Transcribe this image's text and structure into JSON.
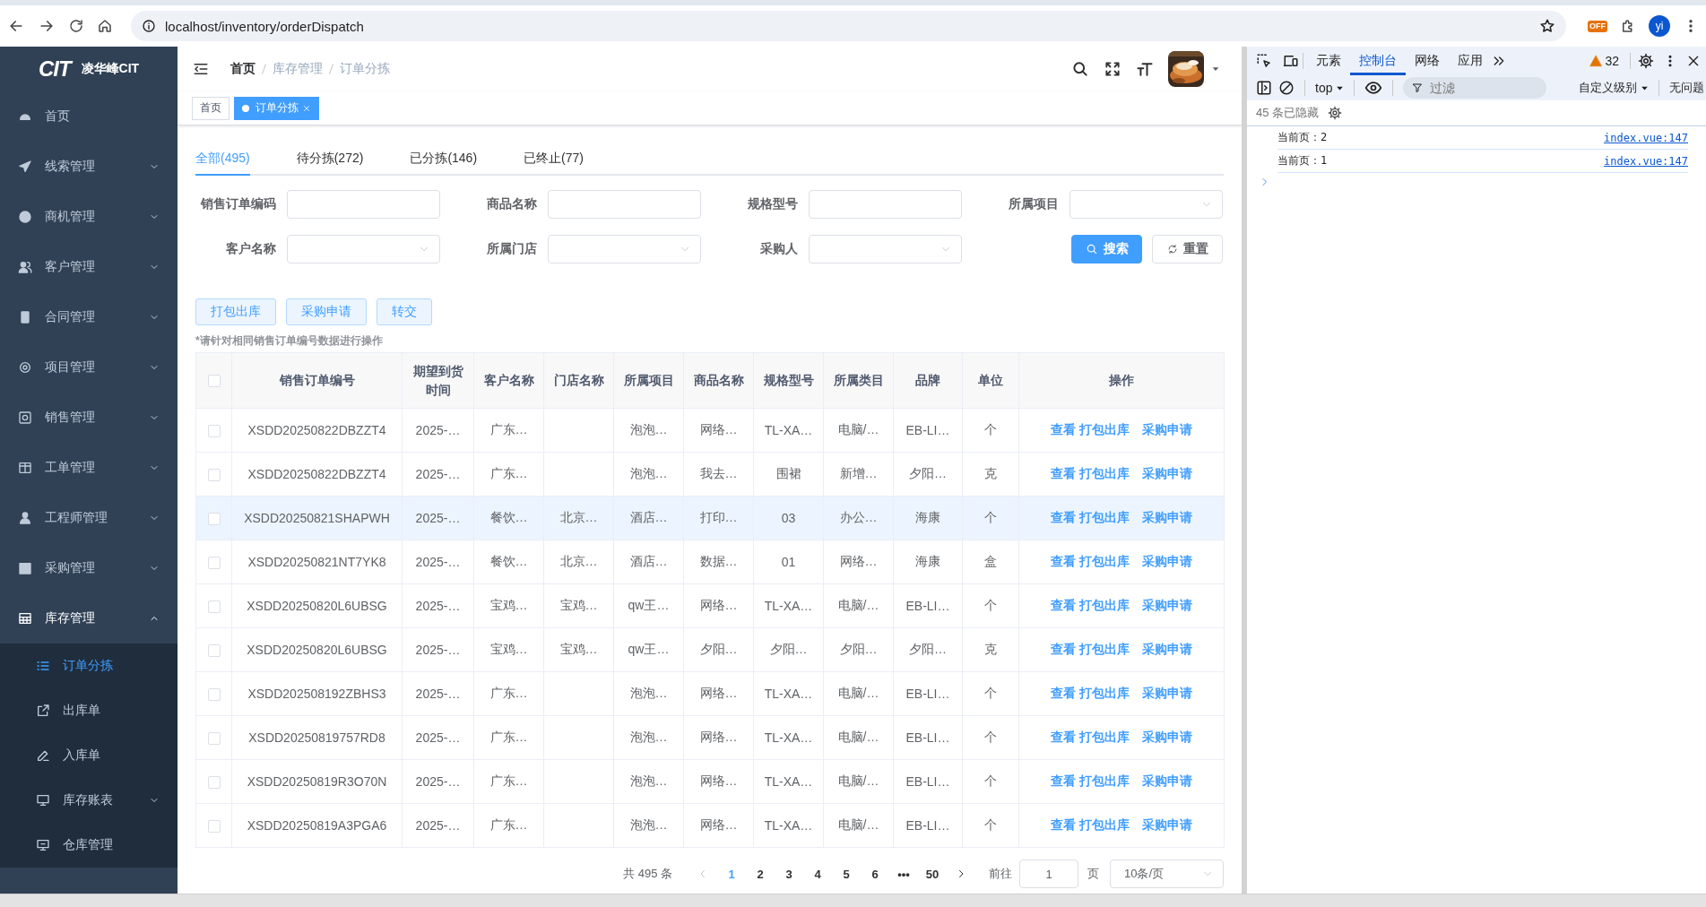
{
  "browser": {
    "url": "localhost/inventory/orderDispatch",
    "extension_badge": "OFF",
    "profile": "yi"
  },
  "sidebar": {
    "logo_mark": "CIT",
    "logo_text": "凌华峰CIT",
    "items": [
      {
        "label": "首页",
        "selected": false
      },
      {
        "label": "线索管理",
        "expanded": false,
        "selected": false
      },
      {
        "label": "商机管理",
        "expanded": false,
        "selected": false
      },
      {
        "label": "客户管理",
        "expanded": false,
        "selected": false
      },
      {
        "label": "合同管理",
        "expanded": false,
        "selected": false
      },
      {
        "label": "项目管理",
        "expanded": false,
        "selected": false
      },
      {
        "label": "销售管理",
        "expanded": false,
        "selected": false
      },
      {
        "label": "工单管理",
        "expanded": false,
        "selected": false
      },
      {
        "label": "工程师管理",
        "expanded": false,
        "selected": false
      },
      {
        "label": "采购管理",
        "expanded": false,
        "selected": false
      },
      {
        "label": "库存管理",
        "expanded": true,
        "selected": false,
        "children": [
          {
            "label": "订单分拣",
            "selected": true
          },
          {
            "label": "出库单",
            "selected": false
          },
          {
            "label": "入库单",
            "selected": false
          },
          {
            "label": "库存账表",
            "expanded": false,
            "selected": false
          },
          {
            "label": "仓库管理",
            "selected": false
          }
        ]
      }
    ]
  },
  "header": {
    "breadcrumb": [
      "首页",
      "库存管理",
      "订单分拣"
    ]
  },
  "tags": [
    {
      "label": "首页",
      "selected": false
    },
    {
      "label": "订单分拣",
      "selected": true
    }
  ],
  "tabs": [
    {
      "label": "全部(495)",
      "selected": true
    },
    {
      "label": "待分拣(272)",
      "selected": false
    },
    {
      "label": "已分拣(146)",
      "selected": false
    },
    {
      "label": "已终止(77)",
      "selected": false
    }
  ],
  "filters": [
    {
      "label": "销售订单编码",
      "kind": "input"
    },
    {
      "label": "商品名称",
      "kind": "input"
    },
    {
      "label": "规格型号",
      "kind": "input"
    },
    {
      "label": "所属项目",
      "kind": "select"
    },
    {
      "label": "客户名称",
      "kind": "select"
    },
    {
      "label": "所属门店",
      "kind": "select"
    },
    {
      "label": "采购人",
      "kind": "select"
    }
  ],
  "filter_buttons": [
    {
      "label": "搜索",
      "kind": "primary"
    },
    {
      "label": "重置",
      "kind": "default"
    }
  ],
  "actions": [
    "打包出库",
    "采购申请",
    "转交"
  ],
  "note": "*请针对相同销售订单编号数据进行操作",
  "table": {
    "all_checked": false,
    "columns": [
      "销售订单编号",
      "期望到货时间",
      "客户名称",
      "门店名称",
      "所属项目",
      "商品名称",
      "规格型号",
      "所属类目",
      "品牌",
      "单位",
      "操作"
    ],
    "rows": [
      {
        "checked": false,
        "selected": false,
        "order_no": "XSDD20250822DBZZT4",
        "expected_arrival": "2025-…",
        "customer": "广东…",
        "project": "泡泡…",
        "product": "网络…",
        "spec": "TL-XA…",
        "category": "电脑/…",
        "brand": "EB-LI…",
        "unit": "个",
        "actions": [
          "查看",
          "打包出库",
          "采购申请"
        ]
      },
      {
        "checked": false,
        "selected": false,
        "order_no": "XSDD20250822DBZZT4",
        "expected_arrival": "2025-…",
        "customer": "广东…",
        "project": "泡泡…",
        "product": "我去…",
        "spec": "围裙",
        "category": "新增…",
        "brand": "夕阳…",
        "unit": "克",
        "actions": [
          "查看",
          "打包出库",
          "采购申请"
        ]
      },
      {
        "checked": false,
        "selected": true,
        "order_no": "XSDD20250821SHAPWH",
        "expected_arrival": "2025-…",
        "customer": "餐饮…",
        "store": "北京…",
        "project": "酒店…",
        "product": "打印…",
        "spec": "03",
        "category": "办公…",
        "brand": "海康",
        "unit": "个",
        "actions": [
          "查看",
          "打包出库",
          "采购申请"
        ]
      },
      {
        "checked": false,
        "selected": false,
        "order_no": "XSDD20250821NT7YK8",
        "expected_arrival": "2025-…",
        "customer": "餐饮…",
        "store": "北京…",
        "project": "酒店…",
        "product": "数据…",
        "spec": "01",
        "category": "网络…",
        "brand": "海康",
        "unit": "盒",
        "actions": [
          "查看",
          "打包出库",
          "采购申请"
        ]
      },
      {
        "checked": false,
        "selected": false,
        "order_no": "XSDD20250820L6UBSG",
        "expected_arrival": "2025-…",
        "customer": "宝鸡…",
        "store": "宝鸡…",
        "project": "qw王…",
        "product": "网络…",
        "spec": "TL-XA…",
        "category": "电脑/…",
        "brand": "EB-LI…",
        "unit": "个",
        "actions": [
          "查看",
          "打包出库",
          "采购申请"
        ]
      },
      {
        "checked": false,
        "selected": false,
        "order_no": "XSDD20250820L6UBSG",
        "expected_arrival": "2025-…",
        "customer": "宝鸡…",
        "store": "宝鸡…",
        "project": "qw王…",
        "product": "夕阳…",
        "spec": "夕阳…",
        "category": "夕阳…",
        "brand": "夕阳…",
        "unit": "克",
        "actions": [
          "查看",
          "打包出库",
          "采购申请"
        ]
      },
      {
        "checked": false,
        "selected": false,
        "order_no": "XSDD202508192ZBHS3",
        "expected_arrival": "2025-…",
        "customer": "广东…",
        "project": "泡泡…",
        "product": "网络…",
        "spec": "TL-XA…",
        "category": "电脑/…",
        "brand": "EB-LI…",
        "unit": "个",
        "actions": [
          "查看",
          "打包出库",
          "采购申请"
        ]
      },
      {
        "checked": false,
        "selected": false,
        "order_no": "XSDD20250819757RD8",
        "expected_arrival": "2025-…",
        "customer": "广东…",
        "project": "泡泡…",
        "product": "网络…",
        "spec": "TL-XA…",
        "category": "电脑/…",
        "brand": "EB-LI…",
        "unit": "个",
        "actions": [
          "查看",
          "打包出库",
          "采购申请"
        ]
      },
      {
        "checked": false,
        "selected": false,
        "order_no": "XSDD20250819R3O70N",
        "expected_arrival": "2025-…",
        "customer": "广东…",
        "project": "泡泡…",
        "product": "网络…",
        "spec": "TL-XA…",
        "category": "电脑/…",
        "brand": "EB-LI…",
        "unit": "个",
        "actions": [
          "查看",
          "打包出库",
          "采购申请"
        ]
      },
      {
        "checked": false,
        "selected": false,
        "order_no": "XSDD20250819A3PGA6",
        "expected_arrival": "2025-…",
        "customer": "广东…",
        "project": "泡泡…",
        "product": "网络…",
        "spec": "TL-XA…",
        "category": "电脑/…",
        "brand": "EB-LI…",
        "unit": "个",
        "actions": [
          "查看",
          "打包出库",
          "采购申请"
        ]
      }
    ]
  },
  "pagination": {
    "total": "共 495 条",
    "pages": [
      {
        "label": "1",
        "selected": true
      },
      {
        "label": "2",
        "selected": false
      },
      {
        "label": "3",
        "selected": false
      },
      {
        "label": "4",
        "selected": false
      },
      {
        "label": "5",
        "selected": false
      },
      {
        "label": "6",
        "selected": false
      },
      {
        "label": "•••",
        "selected": false
      },
      {
        "label": "50",
        "selected": false
      }
    ],
    "goto_label": "前往",
    "goto_value": "1",
    "goto_unit": "页",
    "page_size": "10条/页"
  },
  "devtools": {
    "tabs": [
      {
        "label": "元素",
        "selected": false
      },
      {
        "label": "控制台",
        "selected": true
      },
      {
        "label": "网络",
        "selected": false
      },
      {
        "label": "应用",
        "selected": false
      }
    ],
    "warnings": "32",
    "context": "top",
    "filter": {
      "placeholder": "过滤"
    },
    "levels": "自定义级别",
    "issues": "无问题",
    "hidden": "45 条已隐藏",
    "logs": [
      {
        "message": "当前页：2",
        "source": "index.vue:147"
      },
      {
        "message": "当前页：1",
        "source": "index.vue:147"
      }
    ]
  }
}
